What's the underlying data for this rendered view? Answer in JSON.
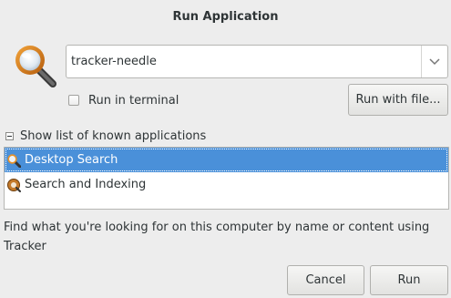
{
  "window": {
    "title": "Run Application"
  },
  "command": {
    "value": "tracker-needle"
  },
  "run_in_terminal": {
    "label": "Run in terminal",
    "checked": false
  },
  "buttons": {
    "run_with_file": "Run with file...",
    "cancel": "Cancel",
    "run": "Run"
  },
  "expander": {
    "label": "Show list of known applications",
    "expanded": true
  },
  "apps": [
    {
      "name": "Desktop Search",
      "icon": "magnifier-icon",
      "selected": true
    },
    {
      "name": "Search and Indexing",
      "icon": "search-indexing-icon",
      "selected": false
    }
  ],
  "description": "Find what you're looking for on this computer by name or content using Tracker",
  "colors": {
    "selection": "#4a90d9",
    "background": "#ededed"
  }
}
